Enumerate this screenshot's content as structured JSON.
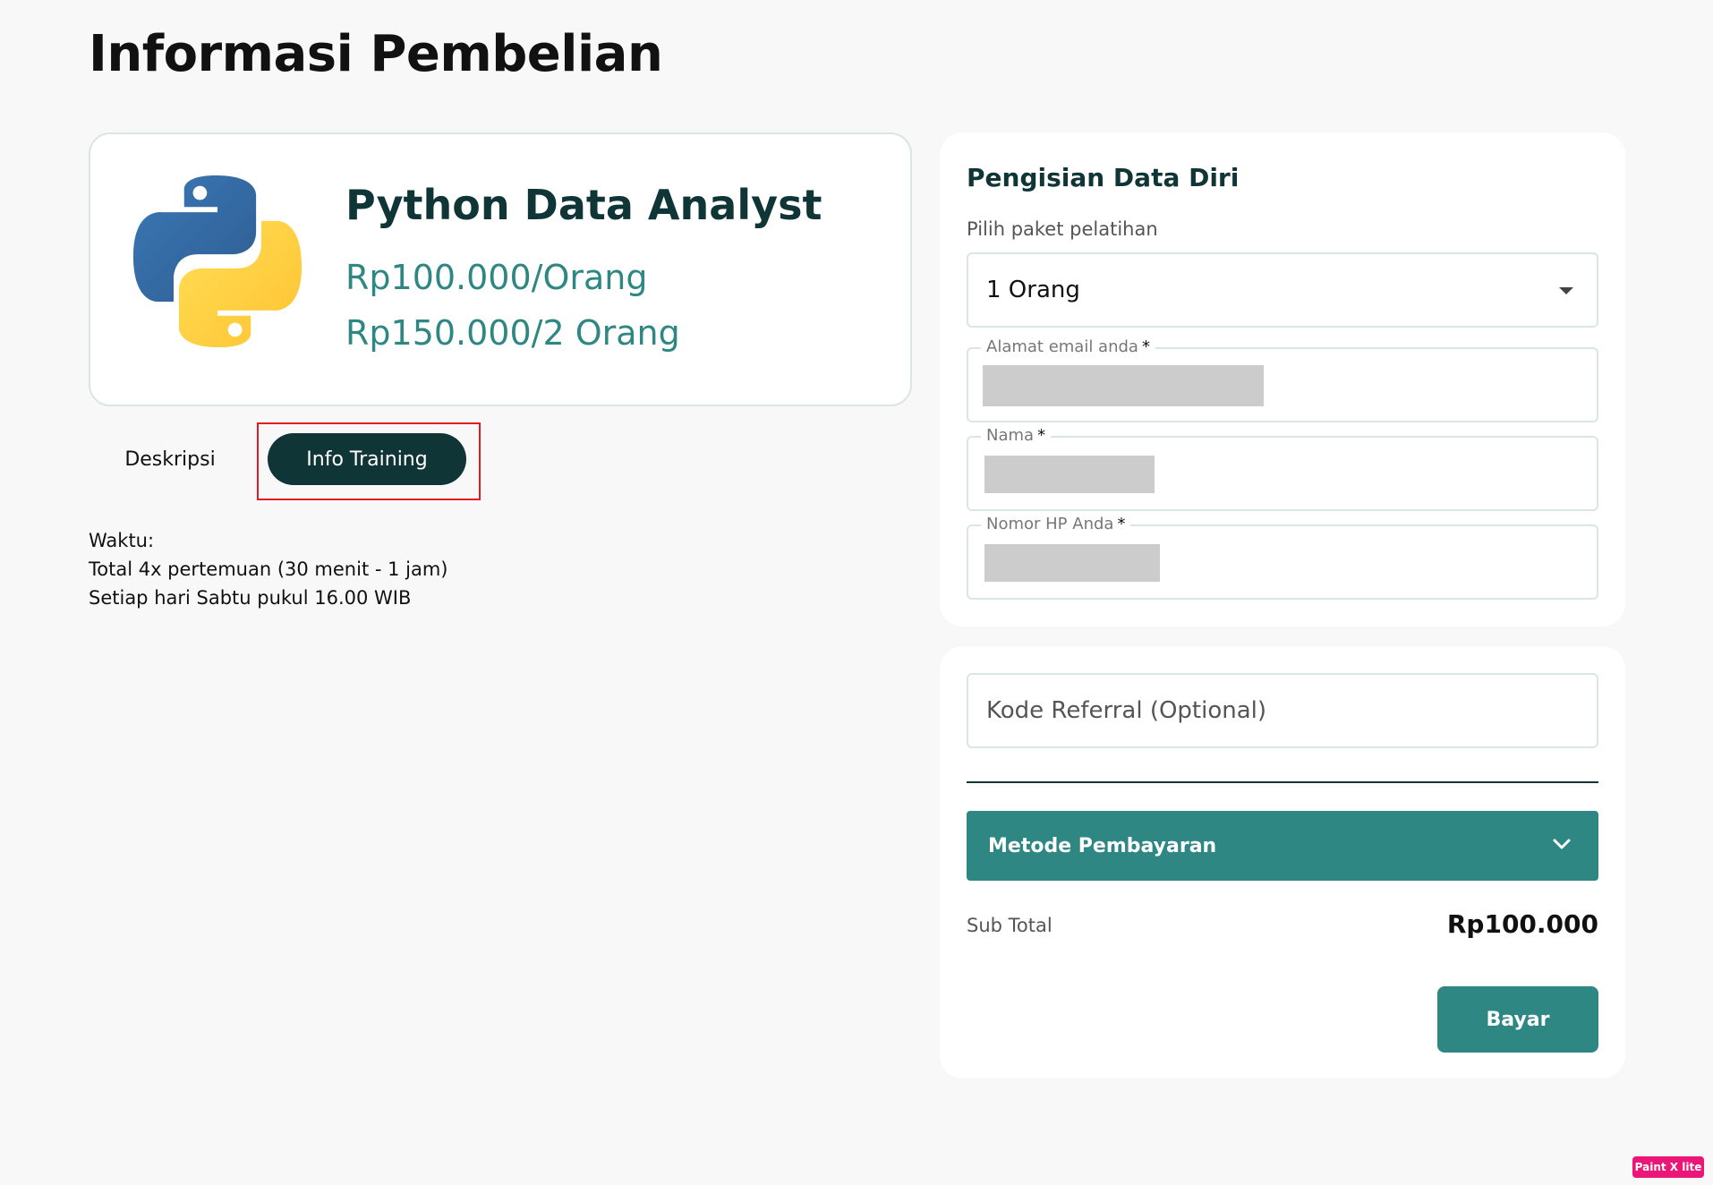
{
  "page": {
    "title": "Informasi Pembelian"
  },
  "product": {
    "logo_icon": "python-logo",
    "name": "Python Data Analyst",
    "price_single": "Rp100.000/Orang",
    "price_pair": "Rp150.000/2 Orang"
  },
  "tabs": [
    {
      "label": "Deskripsi",
      "active": false
    },
    {
      "label": "Info Training",
      "active": true
    }
  ],
  "training_info": {
    "line1": "Waktu:",
    "line2": "Total 4x pertemuan (30 menit - 1 jam)",
    "line3": "Setiap hari Sabtu pukul 16.00 WIB"
  },
  "personal_data": {
    "title": "Pengisian Data Diri",
    "package_label": "Pilih paket pelatihan",
    "package_value": "1 Orang",
    "email_label": "Alamat email anda",
    "name_label": "Nama",
    "phone_label": "Nomor HP Anda",
    "required_mark": "*"
  },
  "payment": {
    "referral_placeholder": "Kode Referral (Optional)",
    "method_label": "Metode Pembayaran",
    "subtotal_label": "Sub Total",
    "subtotal_value": "Rp100.000",
    "pay_button": "Bayar"
  },
  "watermark": {
    "text": "Paint X lite"
  },
  "colors": {
    "dark_teal": "#0f3537",
    "teal": "#2e8782",
    "border": "#d9e6e4",
    "highlight": "#e01b24"
  }
}
